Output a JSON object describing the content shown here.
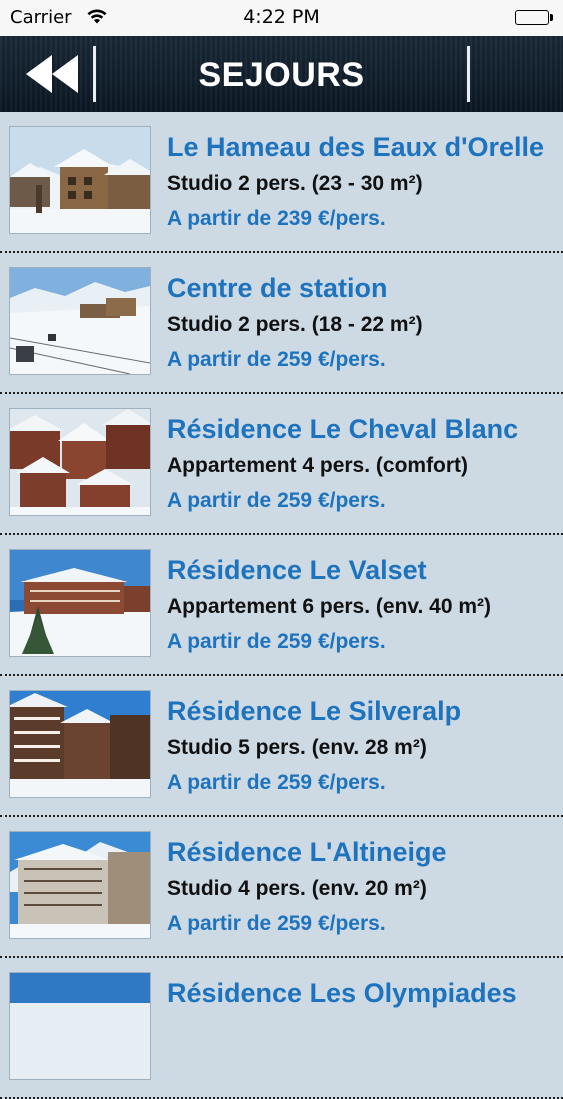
{
  "status_bar": {
    "carrier": "Carrier",
    "time": "4:22 PM",
    "icons": [
      "wifi-icon",
      "battery-icon"
    ]
  },
  "nav": {
    "title": "SEJOURS",
    "back_icon": "rewind-icon",
    "background_color": "#0f1c29"
  },
  "colors": {
    "title": "#1e73be",
    "subtitle": "#111111",
    "price": "#1e73be",
    "list_background": "#cdd9e3"
  },
  "listings": [
    {
      "title": "Le Hameau des Eaux d'Orelle",
      "subtitle": "Studio 2 pers. (23 - 30 m²)",
      "price": "A partir de 239 €/pers."
    },
    {
      "title": "Centre de station",
      "subtitle": "Studio 2 pers. (18 - 22 m²)",
      "price": "A partir de 259 €/pers."
    },
    {
      "title": "Résidence Le Cheval Blanc",
      "subtitle": "Appartement 4 pers. (comfort)",
      "price": "A partir de 259 €/pers."
    },
    {
      "title": "Résidence Le Valset",
      "subtitle": "Appartement 6 pers. (env. 40 m²)",
      "price": "A partir de 259 €/pers."
    },
    {
      "title": "Résidence Le Silveralp",
      "subtitle": "Studio 5 pers. (env. 28 m²)",
      "price": "A partir de 259 €/pers."
    },
    {
      "title": "Résidence L'Altineige",
      "subtitle": "Studio 4 pers. (env. 20 m²)",
      "price": "A partir de 259 €/pers."
    },
    {
      "title": "Résidence Les Olympiades",
      "subtitle": "",
      "price": ""
    }
  ]
}
